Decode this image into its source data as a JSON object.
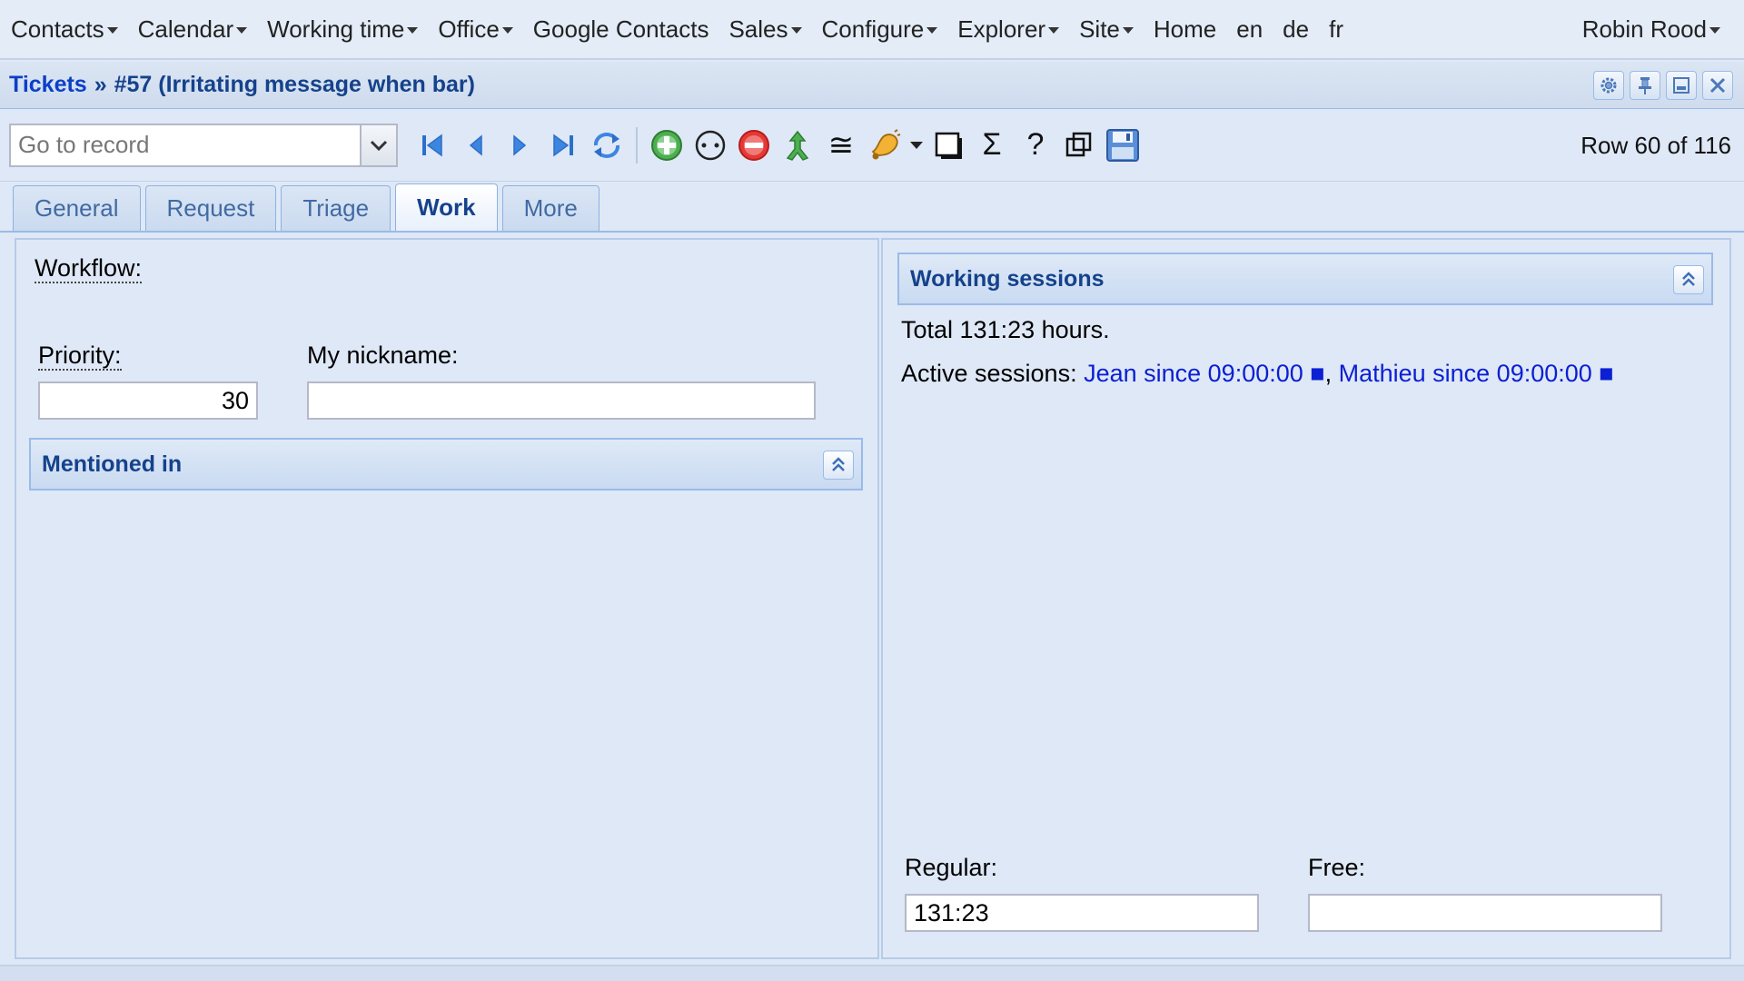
{
  "menubar": {
    "items": [
      {
        "label": "Contacts",
        "dropdown": true
      },
      {
        "label": "Calendar",
        "dropdown": true
      },
      {
        "label": "Working time",
        "dropdown": true
      },
      {
        "label": "Office",
        "dropdown": true
      },
      {
        "label": "Google Contacts",
        "dropdown": false
      },
      {
        "label": "Sales",
        "dropdown": true
      },
      {
        "label": "Configure",
        "dropdown": true
      },
      {
        "label": "Explorer",
        "dropdown": true
      },
      {
        "label": "Site",
        "dropdown": true
      },
      {
        "label": "Home",
        "dropdown": false
      },
      {
        "label": "en",
        "dropdown": false
      },
      {
        "label": "de",
        "dropdown": false
      },
      {
        "label": "fr",
        "dropdown": false
      }
    ],
    "user": "Robin Rood"
  },
  "title": {
    "crumb": "Tickets",
    "separator": "»",
    "record": "#57 (Irritating message when bar)"
  },
  "toolbar": {
    "goto_placeholder": "Go to record",
    "row_info": "Row 60 of 116",
    "glyphs": {
      "approx": "≅",
      "sum": "Σ",
      "help": "?"
    }
  },
  "tabs": [
    {
      "label": "General",
      "active": false
    },
    {
      "label": "Request",
      "active": false
    },
    {
      "label": "Triage",
      "active": false
    },
    {
      "label": "Work",
      "active": true
    },
    {
      "label": "More",
      "active": false
    }
  ],
  "work": {
    "workflow_label": "Workflow:",
    "priority_label": "Priority:",
    "priority_value": "30",
    "nickname_label": "My nickname:",
    "nickname_value": "",
    "mentioned_title": "Mentioned in"
  },
  "sessions": {
    "title": "Working sessions",
    "total": "Total 131:23 hours.",
    "active_prefix": "Active sessions: ",
    "active": [
      {
        "text": "Jean since 09:00:00 ■"
      },
      {
        "text": "Mathieu since 09:00:00 ■"
      }
    ],
    "active_separator": ", ",
    "regular_label": "Regular:",
    "regular_value": "131:23",
    "free_label": "Free:",
    "free_value": ""
  },
  "colors": {
    "accent": "#15428b",
    "link": "#0b1fd3",
    "panel_bg": "#dfe8f6",
    "border": "#99bbe8"
  }
}
